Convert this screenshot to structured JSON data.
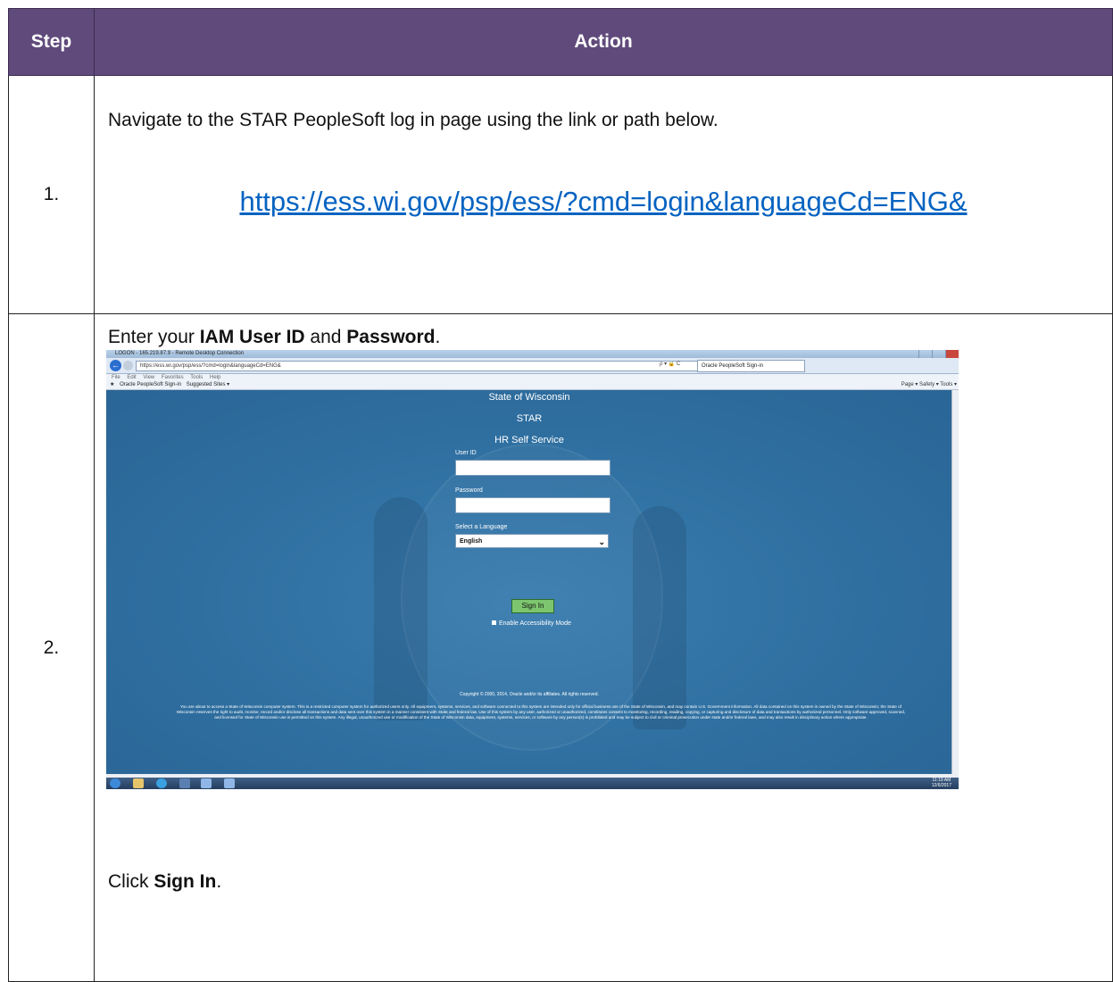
{
  "table": {
    "header": {
      "step": "Step",
      "action": "Action"
    }
  },
  "step1": {
    "number": "1.",
    "instruction": "Navigate to the STAR PeopleSoft log in page using the link or path below.",
    "link": "https://ess.wi.gov/psp/ess/?cmd=login&languageCd=ENG&"
  },
  "step2": {
    "number": "2.",
    "instruction_prefix": "Enter your ",
    "instruction_bold1": "IAM User ID",
    "instruction_mid": " and ",
    "instruction_bold2": "Password",
    "instruction_suffix": ".",
    "click_prefix": "Click ",
    "click_bold": "Sign In",
    "click_suffix": "."
  },
  "screenshot": {
    "window_title": "LOGON - 165.219.87.9 - Remote Desktop Connection",
    "address_url": "https://ess.wi.gov/psp/ess/?cmd=login&languageCd=ENG&",
    "address_controls": "ρ ▾ 🔒 C",
    "tab_title": "Oracle PeopleSoft Sign-in",
    "menu": [
      "File",
      "Edit",
      "View",
      "Favorites",
      "Tools",
      "Help"
    ],
    "favorites": [
      "Oracle PeopleSoft Sign-in",
      "Suggested Sites ▾"
    ],
    "command_bar": "Page ▾   Safety ▾   Tools ▾",
    "heading1": "State of Wisconsin",
    "heading2": "STAR",
    "heading3": "HR Self Service",
    "userid_label": "User ID",
    "password_label": "Password",
    "language_label": "Select a Language",
    "language_value": "English",
    "signin_label": "Sign In",
    "accessibility_label": "Enable Accessibility Mode",
    "copyright": "Copyright © 2000, 2014, Oracle and/or its affiliates. All rights reserved.",
    "disclaimer": "You are about to access a State of Wisconsin computer system. This is a restricted computer system for authorized users only. All equipment, systems, services, and software connected to this system are intended only for official business use of the State of Wisconsin, and may contain U.S. Government information. All data contained on this system is owned by the State of Wisconsin; the State of Wisconsin reserves the right to audit, monitor, record and/or disclose all transactions and data sent over this system in a manner consistent with State and federal law. Use of this system by any user, authorized or unauthorized, constitutes consent to monitoring, recording, reading, copying, or capturing and disclosure of data and transactions by authorized personnel. Only software approved, scanned, and licensed for State of Wisconsin use is permitted on this system. Any illegal, unauthorized use or modification of the State of Wisconsin data, equipment, systems, services, or software by any person(s) is prohibited and may be subject to civil or criminal prosecution under state and/or federal laws, and may also result in disciplinary action where appropriate.",
    "clock_time": "11:19 AM",
    "clock_date": "12/6/2017",
    "colors": {
      "login_bg": "#2f6ea0",
      "signin_button": "#7dc66f",
      "header_purple": "#604a7b",
      "link": "#0563c1"
    }
  }
}
